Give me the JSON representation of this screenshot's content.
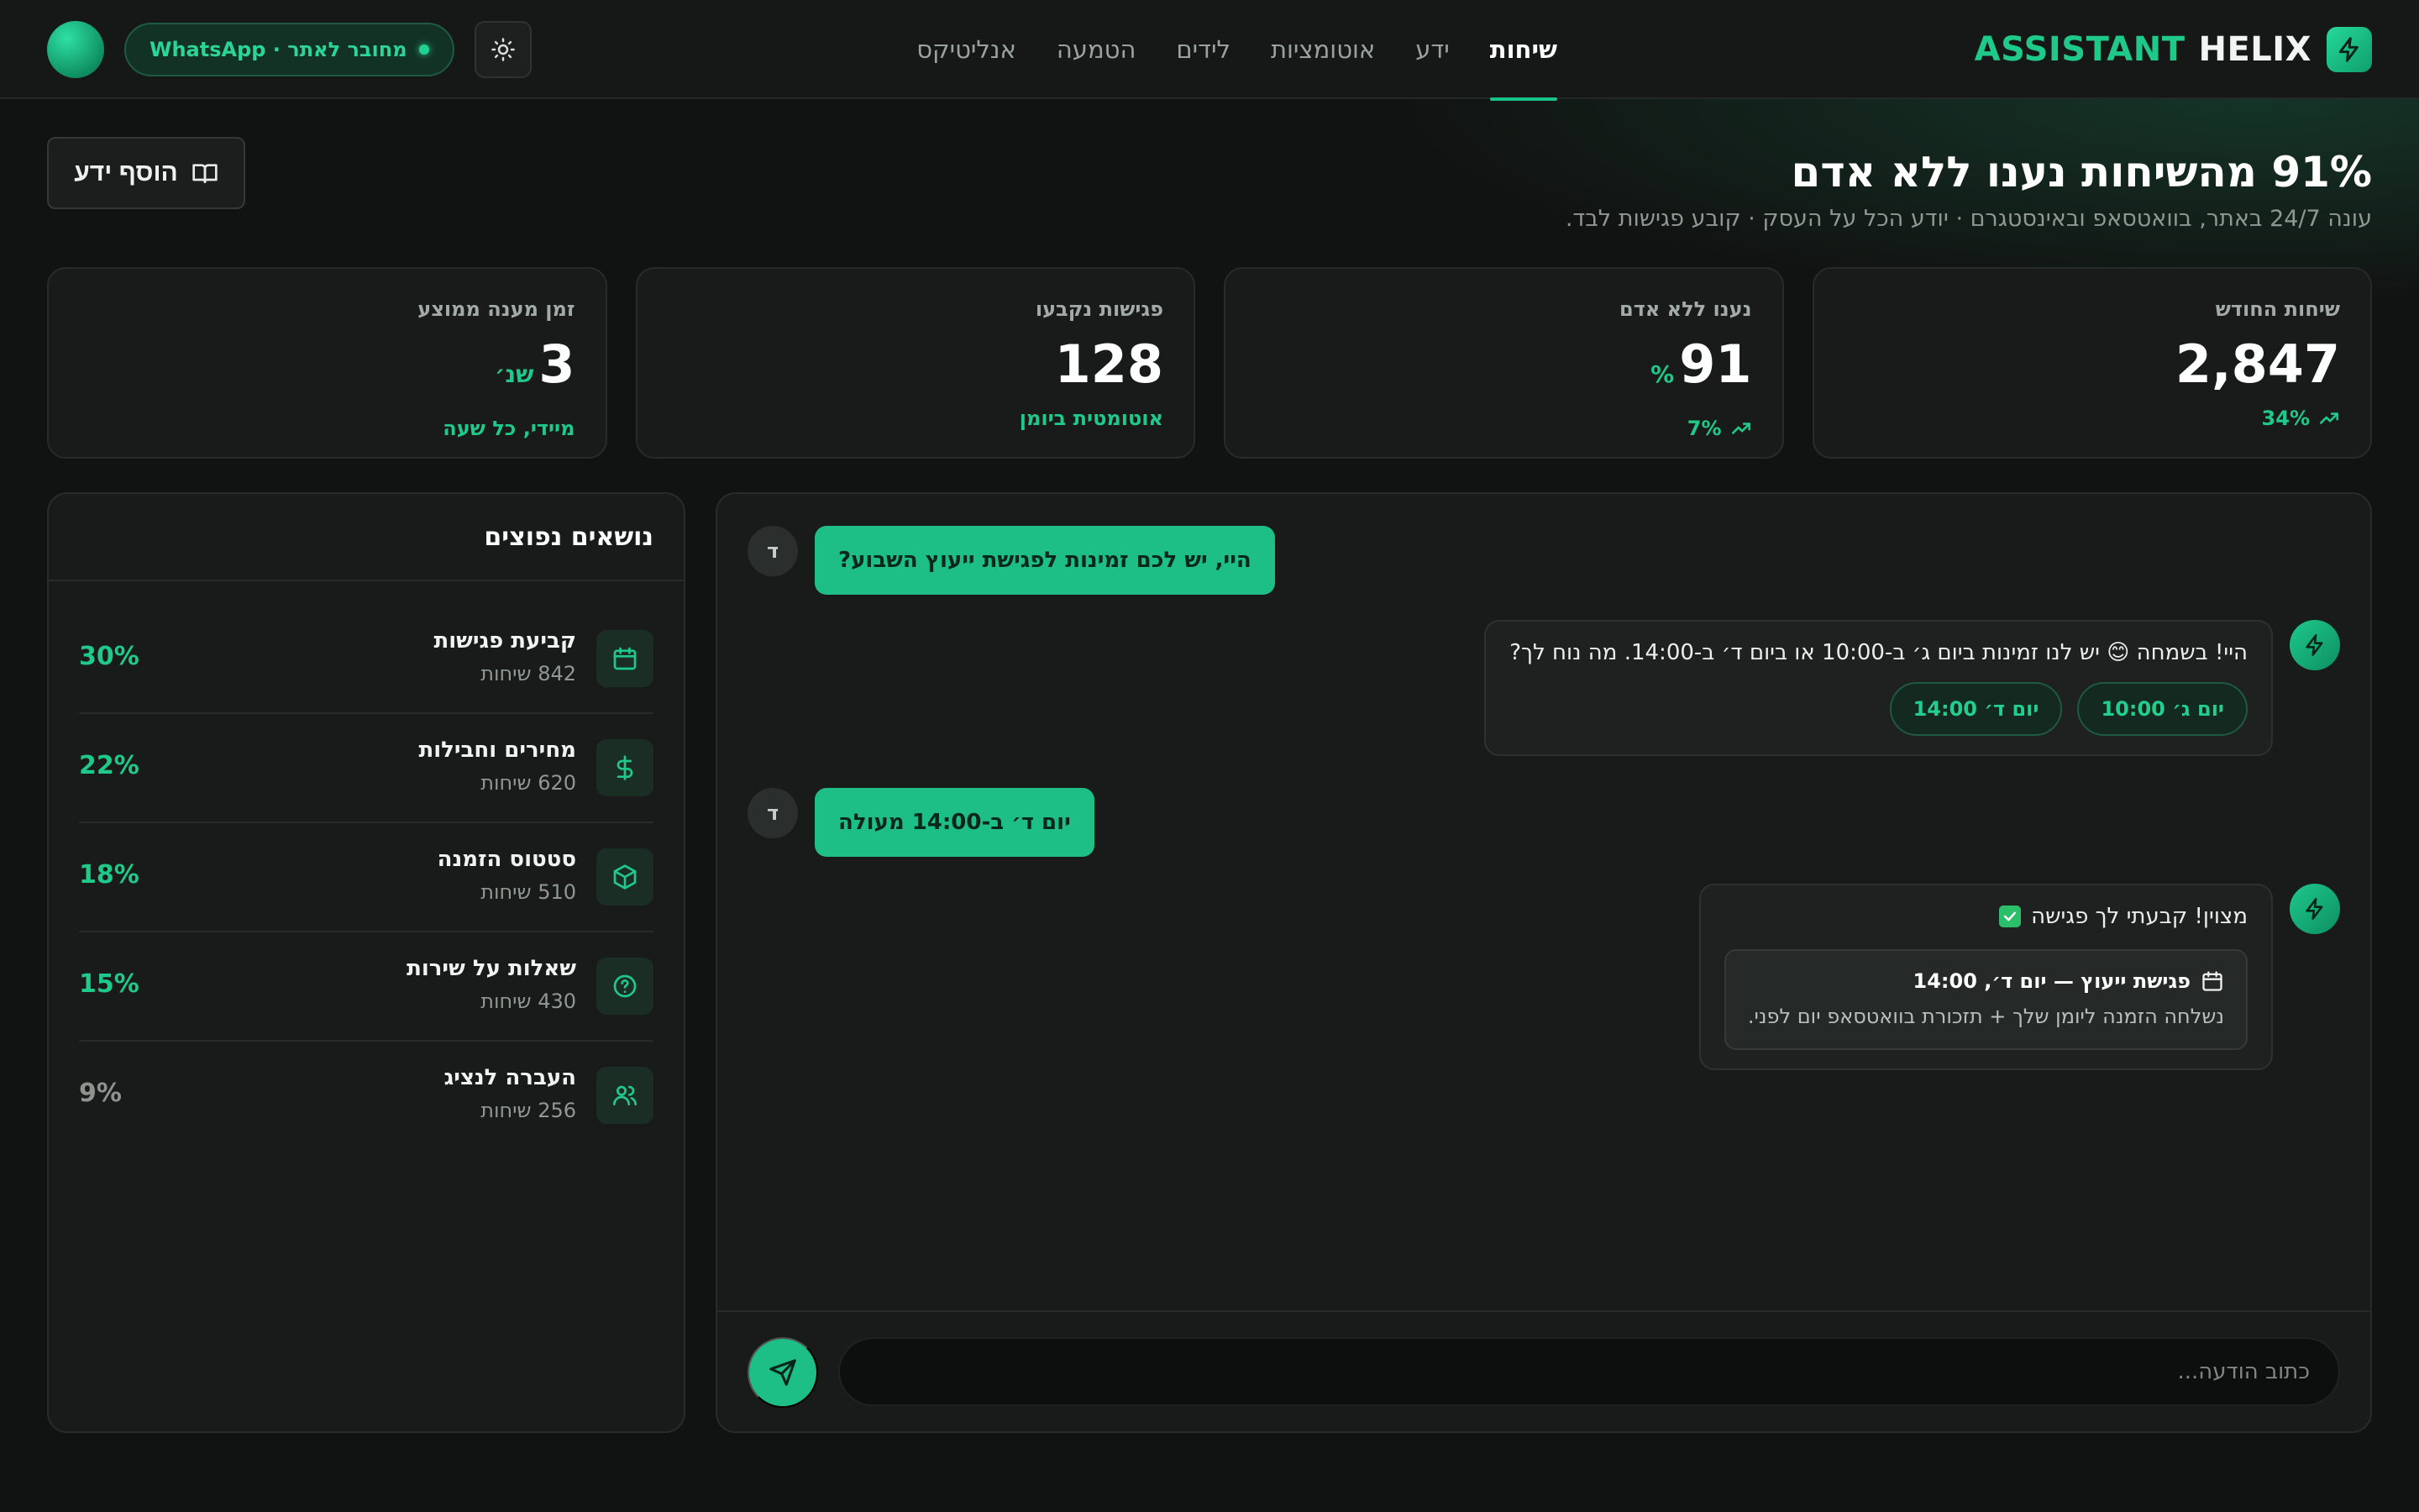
{
  "brand": {
    "word1": "HELIX",
    "word2": "ASSISTANT"
  },
  "nav": {
    "items": [
      {
        "label": "שיחות",
        "active": true
      },
      {
        "label": "ידע",
        "active": false
      },
      {
        "label": "אוטומציות",
        "active": false
      },
      {
        "label": "לידים",
        "active": false
      },
      {
        "label": "הטמעה",
        "active": false
      },
      {
        "label": "אנליטיקס",
        "active": false
      }
    ]
  },
  "status": {
    "connection": "מחובר לאתר · WhatsApp"
  },
  "hero": {
    "title": "91% מהשיחות נענו ללא אדם",
    "subtitle": "עונה 24/7 באתר, בוואטסאפ ובאינסטגרם · יודע הכל על העסק · קובע פגישות לבד.",
    "add_button": "הוסף ידע"
  },
  "stats": [
    {
      "label": "שיחות החודש",
      "value": "2,847",
      "unit": "",
      "foot": "34%",
      "trend": true
    },
    {
      "label": "נענו ללא אדם",
      "value": "91",
      "unit": "%",
      "foot": "7%",
      "trend": true
    },
    {
      "label": "פגישות נקבעו",
      "value": "128",
      "unit": "",
      "foot": "אוטומטית ביומן",
      "trend": false
    },
    {
      "label": "זמן מענה ממוצע",
      "value": "3",
      "unit": "שנ׳",
      "foot": "מיידי, כל שעה",
      "trend": false
    }
  ],
  "chat": {
    "user_initial": "ד",
    "msg1": "היי, יש לכם זמינות לפגישת ייעוץ השבוע?",
    "bot1": "היי! בשמחה 😊 יש לנו זמינות ביום ג׳ ב-10:00 או ביום ד׳ ב-14:00. מה נוח לך?",
    "chip1": "יום ג׳ 10:00",
    "chip2": "יום ד׳ 14:00",
    "msg2": "יום ד׳ ב-14:00 מעולה",
    "bot2": "מצוין! קבעתי לך פגישה",
    "meeting_title": "פגישת ייעוץ — יום ד׳, 14:00",
    "meeting_note": "נשלחה הזמנה ליומן שלך + תזכורת בוואטסאפ יום לפני.",
    "input_placeholder": "כתוב הודעה..."
  },
  "topics": {
    "title": "נושאים נפוצים",
    "items": [
      {
        "name": "קביעת פגישות",
        "count": "842 שיחות",
        "pct": "30%",
        "icon": "calendar-icon"
      },
      {
        "name": "מחירים וחבילות",
        "count": "620 שיחות",
        "pct": "22%",
        "icon": "dollar-icon"
      },
      {
        "name": "סטטוס הזמנה",
        "count": "510 שיחות",
        "pct": "18%",
        "icon": "package-icon"
      },
      {
        "name": "שאלות על שירות",
        "count": "430 שיחות",
        "pct": "15%",
        "icon": "question-icon"
      },
      {
        "name": "העברה לנציג",
        "count": "256 שיחות",
        "pct": "9%",
        "icon": "users-icon"
      }
    ]
  },
  "colors": {
    "accent": "#1fc98a",
    "background": "#111312",
    "card": "#181b1a",
    "user_bubble": "#1dbf86"
  }
}
